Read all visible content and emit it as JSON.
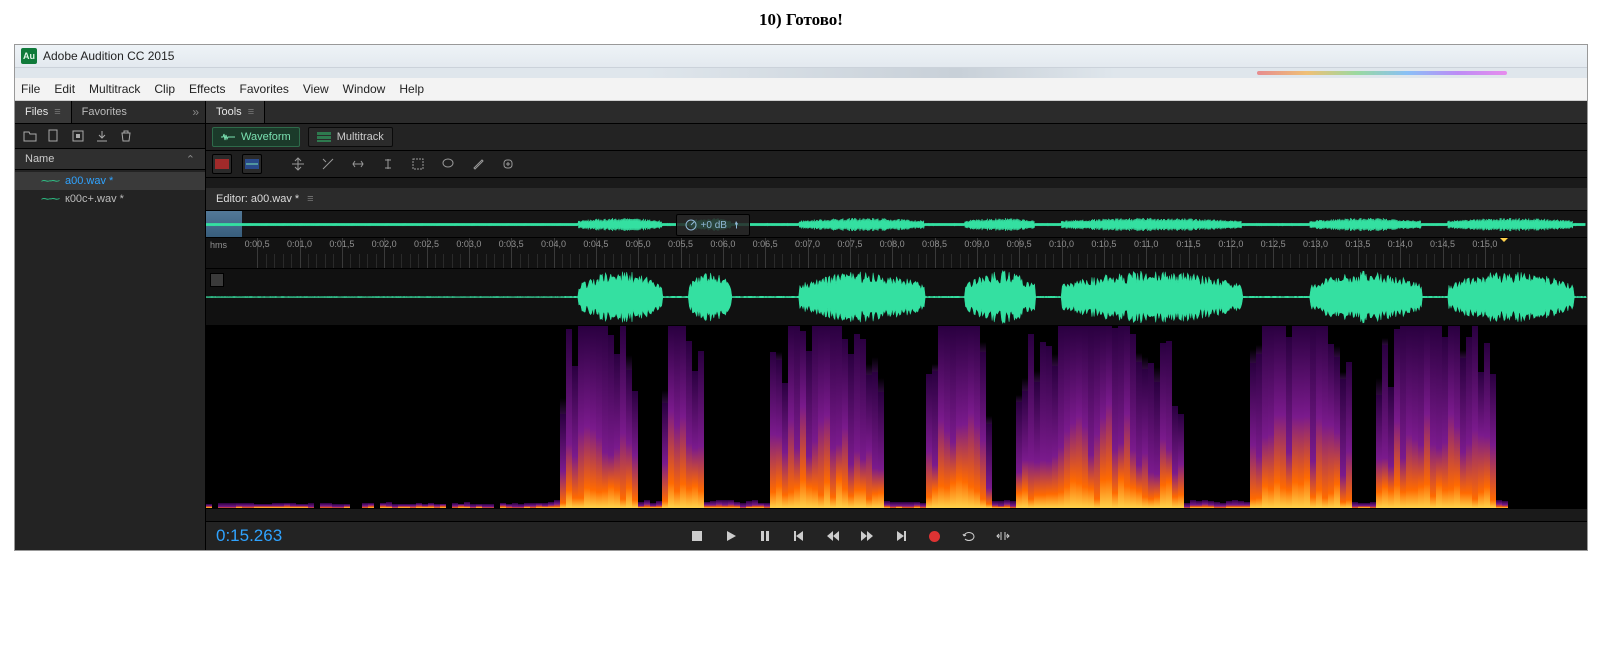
{
  "caption": "10) Готово!",
  "titlebar": {
    "badge": "Au",
    "title": "Adobe Audition CC 2015"
  },
  "menubar": [
    "File",
    "Edit",
    "Multitrack",
    "Clip",
    "Effects",
    "Favorites",
    "View",
    "Window",
    "Help"
  ],
  "sidebar": {
    "tabs": {
      "files": "Files",
      "favorites": "Favorites"
    },
    "name_header": "Name",
    "items": [
      {
        "label": "a00.wav *",
        "selected": true
      },
      {
        "label": "к00c+.wav *",
        "selected": false
      }
    ]
  },
  "tools_panel": {
    "title": "Tools"
  },
  "view_toggle": {
    "waveform": "Waveform",
    "multitrack": "Multitrack"
  },
  "editor": {
    "label": "Editor: a00.wav *"
  },
  "overview": {
    "db_label": "+0 dB"
  },
  "timeline": {
    "hms": "hms",
    "labels": [
      "0:00,5",
      "0:01,0",
      "0:01,5",
      "0:02,0",
      "0:02,5",
      "0:03,0",
      "0:03,5",
      "0:04,0",
      "0:04,5",
      "0:05,0",
      "0:05,5",
      "0:06,0",
      "0:06,5",
      "0:07,0",
      "0:07,5",
      "0:08,0",
      "0:08,5",
      "0:09,0",
      "0:09,5",
      "0:10,0",
      "0:10,5",
      "0:11,0",
      "0:11,5",
      "0:12,0",
      "0:12,5",
      "0:13,0",
      "0:13,5",
      "0:14,0",
      "0:14,5",
      "0:15,0"
    ]
  },
  "transport": {
    "timecode": "0:15.263"
  },
  "colors": {
    "waveform": "#34e0a1",
    "accent_blue": "#2fa3ff",
    "spectro_low": "#1a0033",
    "spectro_mid": "#7a1a8c",
    "spectro_high": "#ff6a00",
    "spectro_peak": "#ffd24a"
  }
}
